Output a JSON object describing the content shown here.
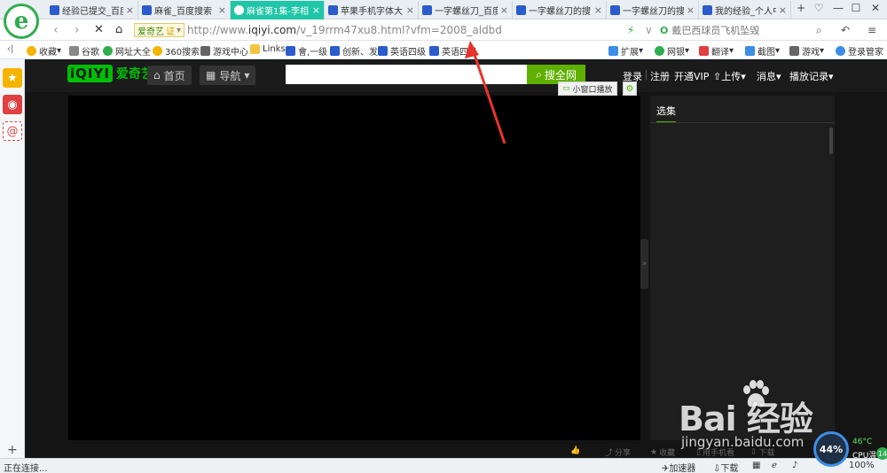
{
  "browser": {
    "tabs": [
      {
        "title": "经验已提交_百度",
        "active": false
      },
      {
        "title": "麻雀_百度搜索",
        "active": false
      },
      {
        "title": "麻雀第1集-李相",
        "active": true
      },
      {
        "title": "苹果手机字体大",
        "active": false
      },
      {
        "title": "一字螺丝刀_百度",
        "active": false
      },
      {
        "title": "一字螺丝刀的搜",
        "active": false
      },
      {
        "title": "一字螺丝刀的搜",
        "active": false
      },
      {
        "title": "我的经验_个人中",
        "active": false
      }
    ],
    "tab_close": "×",
    "tab_new": "+",
    "window_controls": {
      "skin": "♡",
      "min": "—",
      "max": "☐",
      "close": "✕"
    },
    "cert_site": "爱奇艺",
    "cert_badge": "证",
    "url_prefix": "http://www.",
    "url_domain": "iqiyi.com",
    "url_path": "/v_19rrm47xu8.html?vfm=2008_aldbd",
    "search_placeholder": "戴巴西球员飞机坠毁",
    "bookmarks": [
      {
        "label": "收藏",
        "color": "#f5b400"
      },
      {
        "label": "谷歌",
        "color": "#888"
      },
      {
        "label": "网址大全",
        "color": "#2fae4e"
      },
      {
        "label": "360搜索",
        "color": "#f5b400"
      },
      {
        "label": "游戏中心",
        "color": "#666"
      },
      {
        "label": "Links",
        "color": "#f5c542"
      },
      {
        "label": "會,一级",
        "color": "#2b5ccc"
      },
      {
        "label": "创新、发",
        "color": "#2b5ccc"
      },
      {
        "label": "英语四级",
        "color": "#2b5ccc"
      },
      {
        "label": "英语四级",
        "color": "#2b5ccc"
      }
    ],
    "bookmarks_right": [
      "扩展",
      "网银",
      "翻译",
      "截图",
      "游戏",
      "登录管家"
    ],
    "status_text": "正在连接...",
    "status_right": [
      "加速器",
      "下载",
      "100%"
    ]
  },
  "iqiyi": {
    "logo_mark": "iQIYI",
    "logo_cn": "爱奇艺",
    "home": "首页",
    "navi": "导航",
    "search_button": "搜全网",
    "login": "登录",
    "register": "注册",
    "vip": "开通VIP",
    "upload": "上传",
    "messages": "消息",
    "history": "播放记录",
    "mini_play": "小窗口播放",
    "episodes_tab": "选集",
    "bottom_actions": [
      "分享",
      "收藏",
      "用手机看",
      "下载"
    ]
  },
  "watermark": {
    "brand": "Bai  经验",
    "url": "jingyan.baidu.com"
  },
  "cpu": {
    "percent": "44%",
    "temp": "46°C",
    "label": "CPU温",
    "badge": "14"
  }
}
